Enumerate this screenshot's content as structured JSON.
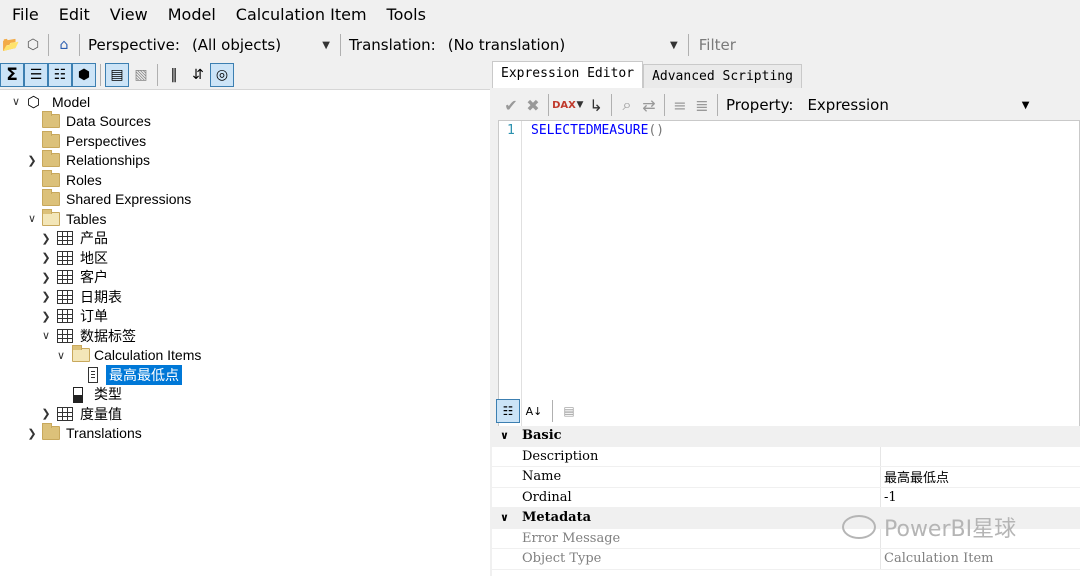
{
  "menu": {
    "items": [
      {
        "label": "File"
      },
      {
        "label": "Edit"
      },
      {
        "label": "View"
      },
      {
        "label": "Model"
      },
      {
        "label": "Calculation Item"
      },
      {
        "label": "Tools"
      }
    ]
  },
  "toolbar": {
    "perspective_label": "Perspective:",
    "perspective_value": "(All objects)",
    "translation_label": "Translation:",
    "translation_value": "(No translation)",
    "filter_placeholder": "Filter"
  },
  "left_toolbar": {
    "icons": [
      "sigma-icon",
      "column-icon",
      "hierarchy-icon",
      "cube-icon",
      "folder-view-icon",
      "hidden-icon",
      "columns-icon",
      "sort-icon",
      "filter-icon"
    ]
  },
  "tree": {
    "model": "Model",
    "data_sources": "Data Sources",
    "perspectives": "Perspectives",
    "relationships": "Relationships",
    "roles": "Roles",
    "shared_expressions": "Shared Expressions",
    "tables": "Tables",
    "table_items": [
      {
        "label": "产品"
      },
      {
        "label": "地区"
      },
      {
        "label": "客户"
      },
      {
        "label": "日期表"
      },
      {
        "label": "订单"
      },
      {
        "label": "数据标签"
      }
    ],
    "calculation_items": "Calculation Items",
    "calc_item": "最高最低点",
    "type_column": "类型",
    "measure_table": "度量值",
    "translations": "Translations"
  },
  "editor": {
    "tabs": [
      {
        "label": "Expression Editor"
      },
      {
        "label": "Advanced Scripting"
      }
    ],
    "property_label": "Property:",
    "property_value": "Expression",
    "line_number": "1",
    "code": "SELECTEDMEASURE",
    "code_parens": "()"
  },
  "properties": {
    "basic": "Basic",
    "description": "Description",
    "description_value": "",
    "name": "Name",
    "name_value": "最高最低点",
    "ordinal": "Ordinal",
    "ordinal_value": "-1",
    "metadata": "Metadata",
    "error_message": "Error Message",
    "error_message_value": "",
    "object_type": "Object Type",
    "object_type_value": "Calculation Item"
  },
  "watermark": "PowerBI星球",
  "colors": {
    "selection": "#0078d7",
    "code_keyword": "#0000ff",
    "line_number": "#2b91af"
  }
}
